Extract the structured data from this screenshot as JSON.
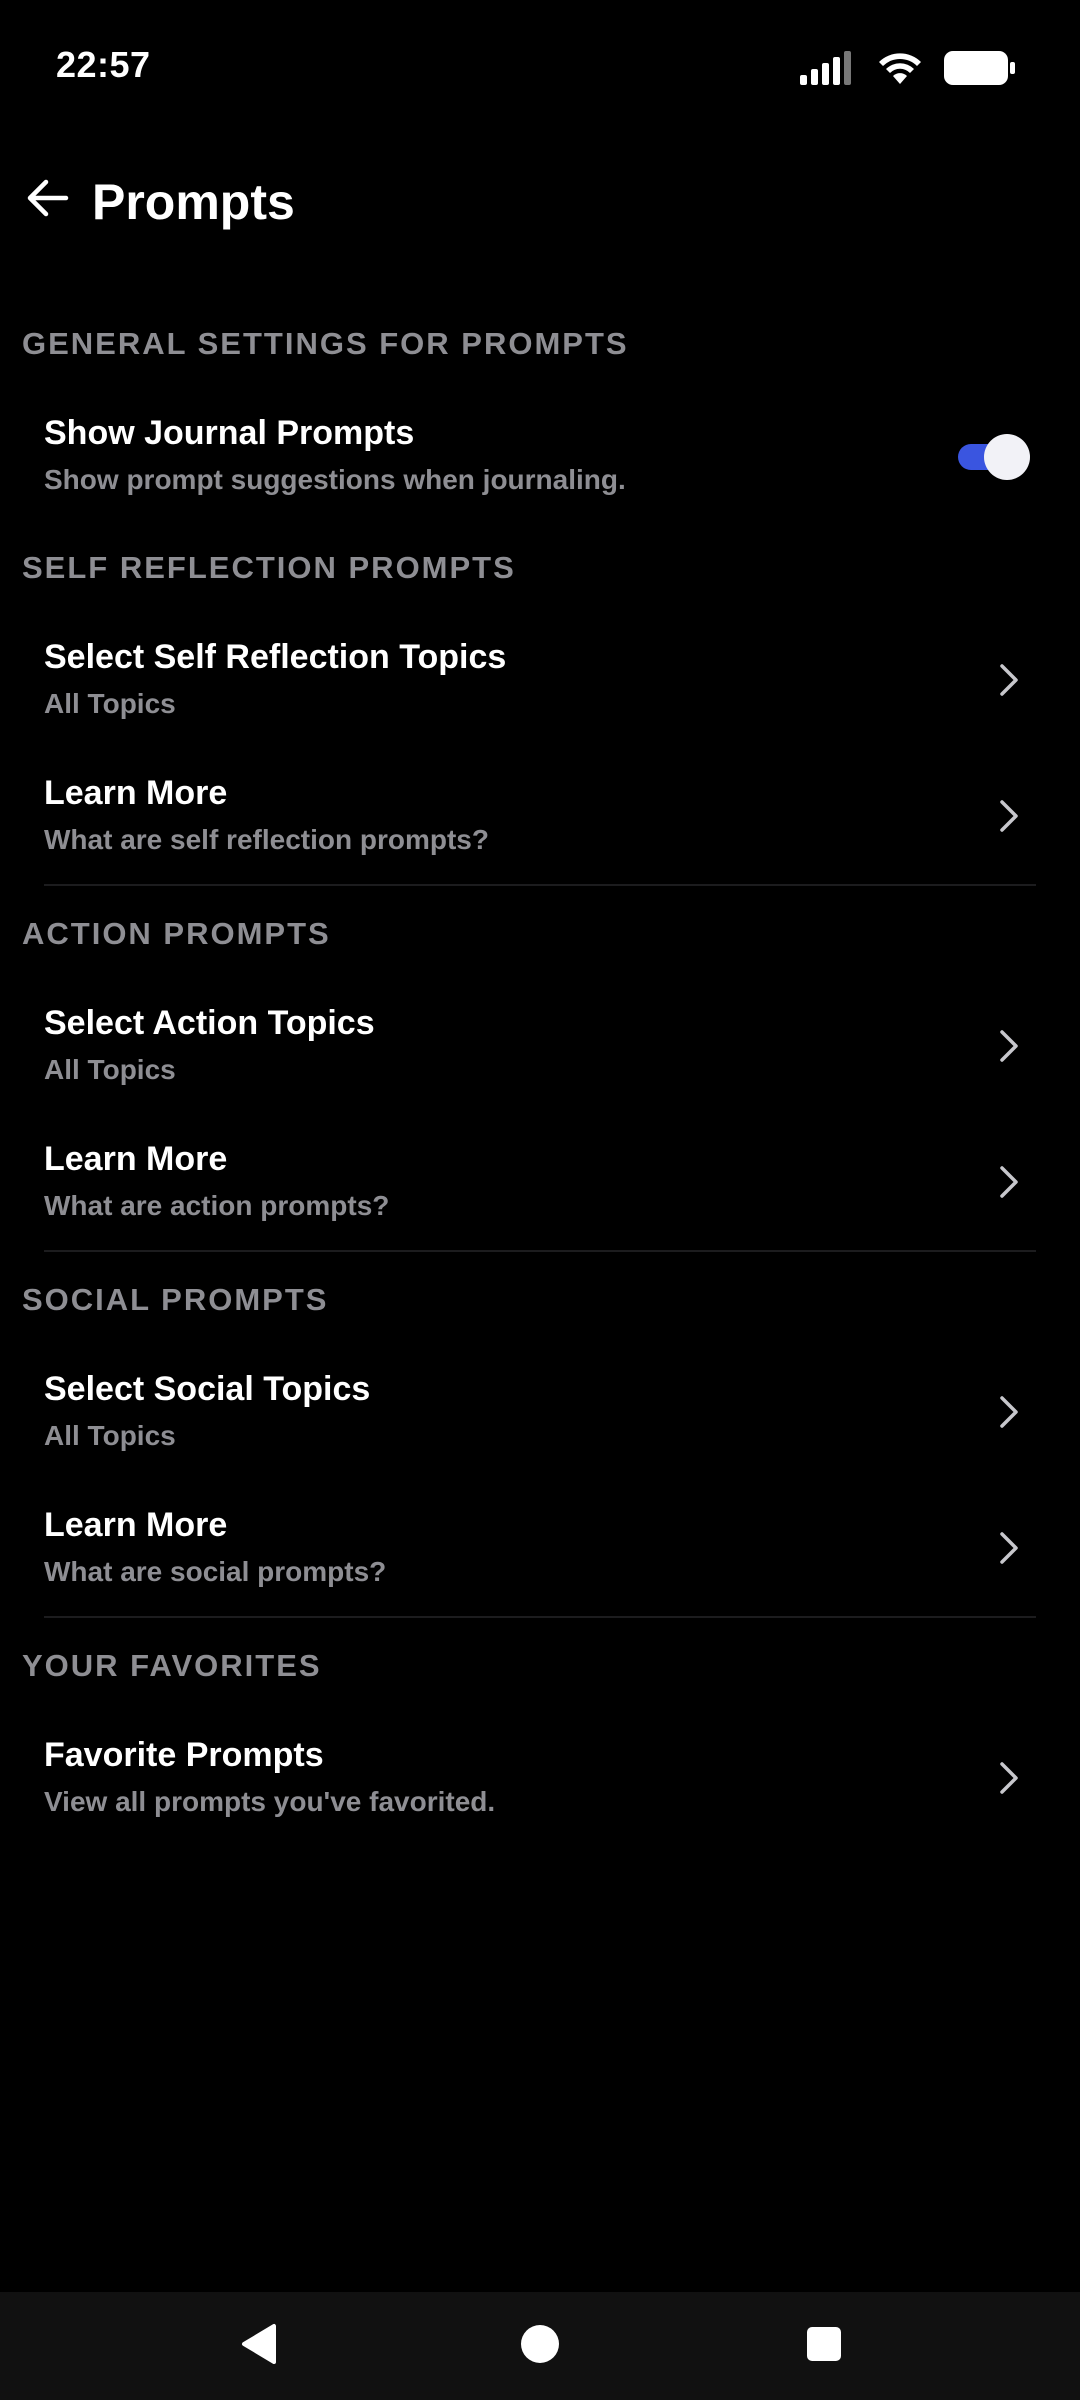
{
  "status_bar": {
    "time": "22:57",
    "icons": [
      "signal-icon",
      "wifi-icon",
      "battery-icon"
    ]
  },
  "header": {
    "title": "Prompts",
    "back_icon": "arrow-left-icon"
  },
  "colors": {
    "background": "#000000",
    "text_primary": "#ffffff",
    "text_secondary": "#8e8e93",
    "toggle_on": "#3a55e0"
  },
  "sections": {
    "general": {
      "header": "GENERAL SETTINGS FOR PROMPTS",
      "show_journal": {
        "title": "Show Journal Prompts",
        "subtitle": "Show prompt suggestions when journaling.",
        "toggle_on": true
      }
    },
    "self_reflection": {
      "header": "SELF REFLECTION PROMPTS",
      "select": {
        "title": "Select Self Reflection Topics",
        "subtitle": "All Topics"
      },
      "learn": {
        "title": "Learn More",
        "subtitle": "What are self reflection prompts?"
      }
    },
    "action": {
      "header": "ACTION PROMPTS",
      "select": {
        "title": "Select Action Topics",
        "subtitle": "All Topics"
      },
      "learn": {
        "title": "Learn More",
        "subtitle": "What are action prompts?"
      }
    },
    "social": {
      "header": "SOCIAL PROMPTS",
      "select": {
        "title": "Select Social Topics",
        "subtitle": "All Topics"
      },
      "learn": {
        "title": "Learn More",
        "subtitle": "What are social prompts?"
      }
    },
    "favorites": {
      "header": "YOUR FAVORITES",
      "favorite": {
        "title": "Favorite Prompts",
        "subtitle": "View all prompts you've favorited."
      }
    }
  },
  "nav_bar": {
    "icons": [
      "nav-back-icon",
      "nav-home-icon",
      "nav-recents-icon"
    ]
  }
}
